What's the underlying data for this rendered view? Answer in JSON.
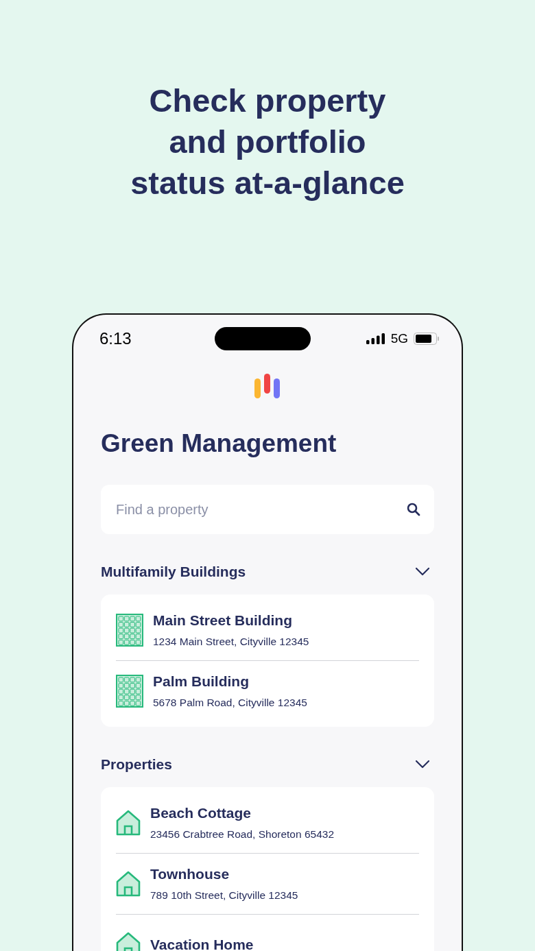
{
  "headline": "Check property\nand portfolio\nstatus at-a-glance",
  "status_bar": {
    "time": "6:13",
    "network": "5G"
  },
  "app": {
    "title": "Green Management",
    "search": {
      "placeholder": "Find a property"
    }
  },
  "sections": [
    {
      "title": "Multifamily Buildings",
      "expanded": true,
      "items": [
        {
          "kind": "building",
          "name": "Main Street Building",
          "address": "1234 Main Street, Cityville 12345"
        },
        {
          "kind": "building",
          "name": "Palm Building",
          "address": "5678 Palm Road, Cityville 12345"
        }
      ]
    },
    {
      "title": "Properties",
      "expanded": true,
      "items": [
        {
          "kind": "house",
          "name": "Beach Cottage",
          "address": "23456 Crabtree Road, Shoreton 65432"
        },
        {
          "kind": "house",
          "name": "Townhouse",
          "address": "789 10th Street, Cityville 12345"
        },
        {
          "kind": "house",
          "name": "Vacation Home"
        }
      ]
    }
  ]
}
